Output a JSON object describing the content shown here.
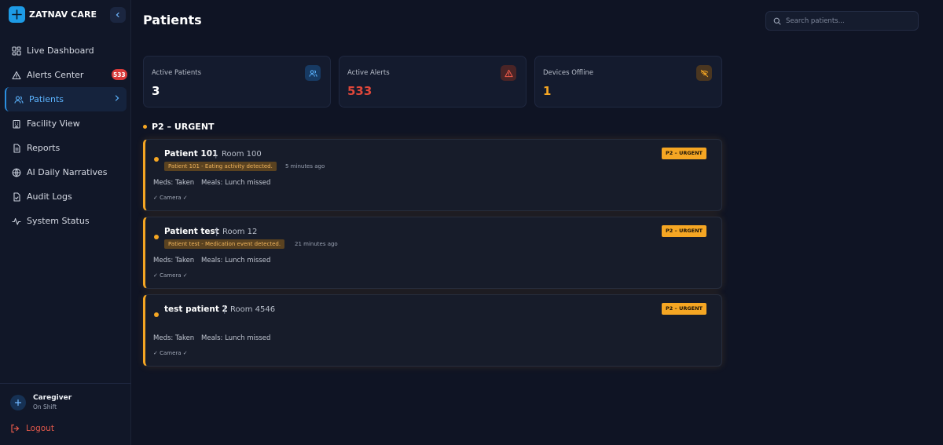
{
  "brand": {
    "name": "ZATNAV CARE"
  },
  "sidebar": {
    "items": [
      {
        "label": "Live Dashboard",
        "icon": "dashboard-icon"
      },
      {
        "label": "Alerts Center",
        "icon": "alert-triangle-icon",
        "badge": "533"
      },
      {
        "label": "Patients",
        "icon": "users-icon",
        "active": true
      },
      {
        "label": "Facility View",
        "icon": "building-icon"
      },
      {
        "label": "Reports",
        "icon": "document-icon"
      },
      {
        "label": "AI Daily Narratives",
        "icon": "globe-icon"
      },
      {
        "label": "Audit Logs",
        "icon": "clipboard-check-icon"
      },
      {
        "label": "System Status",
        "icon": "activity-icon"
      }
    ],
    "user": {
      "name": "Caregiver",
      "status": "On Shift"
    },
    "logout": "Logout"
  },
  "header": {
    "title": "Patients",
    "search": {
      "placeholder": "Search patients...",
      "value": ""
    }
  },
  "stats": [
    {
      "label": "Active Patients",
      "value": "3",
      "color": "#ffffff",
      "icon": "users-icon"
    },
    {
      "label": "Active Alerts",
      "value": "533",
      "color": "#e0473a",
      "icon": "alert-triangle-icon"
    },
    {
      "label": "Devices Offline",
      "value": "1",
      "color": "#f5a623",
      "icon": "wifi-off-icon"
    }
  ],
  "section": {
    "title": "P2 – URGENT"
  },
  "patients": [
    {
      "name": "Patient 101",
      "separator": "|",
      "room": "Room 100",
      "alert": "Patient 101 - Eating activity detected.",
      "time": "5 minutes ago",
      "meds": "Meds: Taken",
      "meals": "Meals: Lunch missed",
      "device": "Camera ✓",
      "priority": "P2 – URGENT"
    },
    {
      "name": "Patient test",
      "separator": "|",
      "room": "Room 12",
      "alert": "Patient test - Medication event detected.",
      "time": "21 minutes ago",
      "meds": "Meds: Taken",
      "meals": "Meals: Lunch missed",
      "device": "Camera ✓",
      "priority": "P2 – URGENT"
    },
    {
      "name": "test patient 2",
      "separator": "|",
      "room": "Room 4546",
      "alert": "",
      "time": "",
      "meds": "Meds: Taken",
      "meals": "Meals: Lunch missed",
      "device": "Camera ✓",
      "priority": "P2 – URGENT"
    }
  ],
  "colors": {
    "accent": "#1d9be6",
    "urgent": "#f5a623",
    "danger": "#e0473a",
    "background": "#0f1424"
  }
}
